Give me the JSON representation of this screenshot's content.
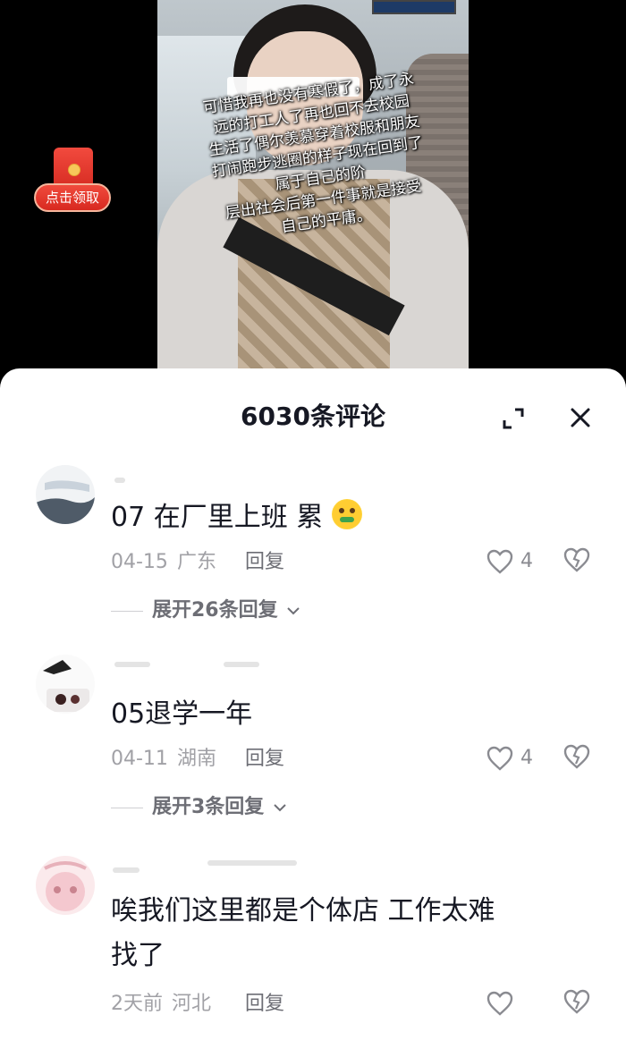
{
  "video": {
    "caption": "可惜我再也没有寒假了，成了永\n远的打工人了再也回不去校园\n生活了偶尔羡慕穿着校服和朋友\n打闹跑步逃圈的样子现在回到了\n属于自己的阶\n层出社会后第一件事就是接受\n自己的平庸。",
    "redpacket_label": "点击领取"
  },
  "comments_panel": {
    "title": "6030条评论",
    "comments": [
      {
        "text": "07 在厂里上班 累",
        "emoji": "money-mouth-face",
        "date": "04-15",
        "region": "广东",
        "reply_label": "回复",
        "likes": "4",
        "expand_label": "展开26条回复"
      },
      {
        "text": "05退学一年",
        "date": "04-11",
        "region": "湖南",
        "reply_label": "回复",
        "likes": "4",
        "expand_label": "展开3条回复"
      },
      {
        "text": "唉我们这里都是个体店 工作太难\n找了",
        "date": "2天前",
        "region": "河北",
        "reply_label": "回复",
        "likes": ""
      }
    ]
  },
  "icons": {
    "expand": "expand-icon",
    "close": "close-icon",
    "like": "heart-outline-icon",
    "dislike": "broken-heart-icon",
    "chevron": "chevron-down-icon"
  },
  "colors": {
    "redpacket": "#e8372b",
    "text_primary": "#161823",
    "text_secondary": "#a1a1a6"
  }
}
